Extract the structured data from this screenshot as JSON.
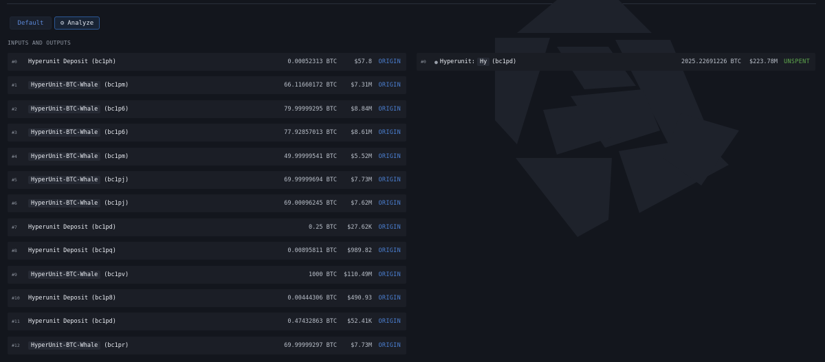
{
  "tabs": {
    "default_label": "Default",
    "analyze_label": "Analyze"
  },
  "section_title": "INPUTS AND OUTPUTS",
  "inputs": [
    {
      "idx": "#0",
      "label": "Hyperunit Deposit",
      "addr": "(bc1ph)",
      "tagged": false,
      "amount": "0.00052313 BTC",
      "usd": "$57.8",
      "status": "ORIGIN"
    },
    {
      "idx": "#1",
      "label": "HyperUnit-BTC-Whale",
      "addr": "(bc1pm)",
      "tagged": true,
      "amount": "66.11660172 BTC",
      "usd": "$7.31M",
      "status": "ORIGIN"
    },
    {
      "idx": "#2",
      "label": "HyperUnit-BTC-Whale",
      "addr": "(bc1p6)",
      "tagged": true,
      "amount": "79.99999295 BTC",
      "usd": "$8.84M",
      "status": "ORIGIN"
    },
    {
      "idx": "#3",
      "label": "HyperUnit-BTC-Whale",
      "addr": "(bc1p6)",
      "tagged": true,
      "amount": "77.92857013 BTC",
      "usd": "$8.61M",
      "status": "ORIGIN"
    },
    {
      "idx": "#4",
      "label": "HyperUnit-BTC-Whale",
      "addr": "(bc1pm)",
      "tagged": true,
      "amount": "49.99999541 BTC",
      "usd": "$5.52M",
      "status": "ORIGIN"
    },
    {
      "idx": "#5",
      "label": "HyperUnit-BTC-Whale",
      "addr": "(bc1pj)",
      "tagged": true,
      "amount": "69.99999694 BTC",
      "usd": "$7.73M",
      "status": "ORIGIN"
    },
    {
      "idx": "#6",
      "label": "HyperUnit-BTC-Whale",
      "addr": "(bc1pj)",
      "tagged": true,
      "amount": "69.00096245 BTC",
      "usd": "$7.62M",
      "status": "ORIGIN"
    },
    {
      "idx": "#7",
      "label": "Hyperunit Deposit",
      "addr": "(bc1pd)",
      "tagged": false,
      "amount": "0.25 BTC",
      "usd": "$27.62K",
      "status": "ORIGIN"
    },
    {
      "idx": "#8",
      "label": "Hyperunit Deposit",
      "addr": "(bc1pq)",
      "tagged": false,
      "amount": "0.00895811 BTC",
      "usd": "$989.82",
      "status": "ORIGIN"
    },
    {
      "idx": "#9",
      "label": "HyperUnit-BTC-Whale",
      "addr": "(bc1pv)",
      "tagged": true,
      "amount": "1000 BTC",
      "usd": "$110.49M",
      "status": "ORIGIN"
    },
    {
      "idx": "#10",
      "label": "Hyperunit Deposit",
      "addr": "(bc1p8)",
      "tagged": false,
      "amount": "0.00444306 BTC",
      "usd": "$490.93",
      "status": "ORIGIN"
    },
    {
      "idx": "#11",
      "label": "Hyperunit Deposit",
      "addr": "(bc1pd)",
      "tagged": false,
      "amount": "0.47432863 BTC",
      "usd": "$52.41K",
      "status": "ORIGIN"
    },
    {
      "idx": "#12",
      "label": "HyperUnit-BTC-Whale",
      "addr": "(bc1pr)",
      "tagged": true,
      "amount": "69.99999297 BTC",
      "usd": "$7.73M",
      "status": "ORIGIN"
    }
  ],
  "outputs": [
    {
      "idx": "#0",
      "prefix": "Hyperunit:",
      "label": "Hy",
      "addr": "(bc1pd)",
      "amount": "2025.22691226 BTC",
      "usd": "$223.78M",
      "status": "UNSPENT"
    }
  ],
  "colors": {
    "background": "#13161d",
    "row": "#1b1e26",
    "origin": "#4b7fd1",
    "unspent": "#5fa84d",
    "accent_border": "#2c5896"
  },
  "icons": {
    "analyze": "settings-gear-icon",
    "output_entity": "entity-avatar-icon",
    "background": "arkham-logo-icon"
  }
}
